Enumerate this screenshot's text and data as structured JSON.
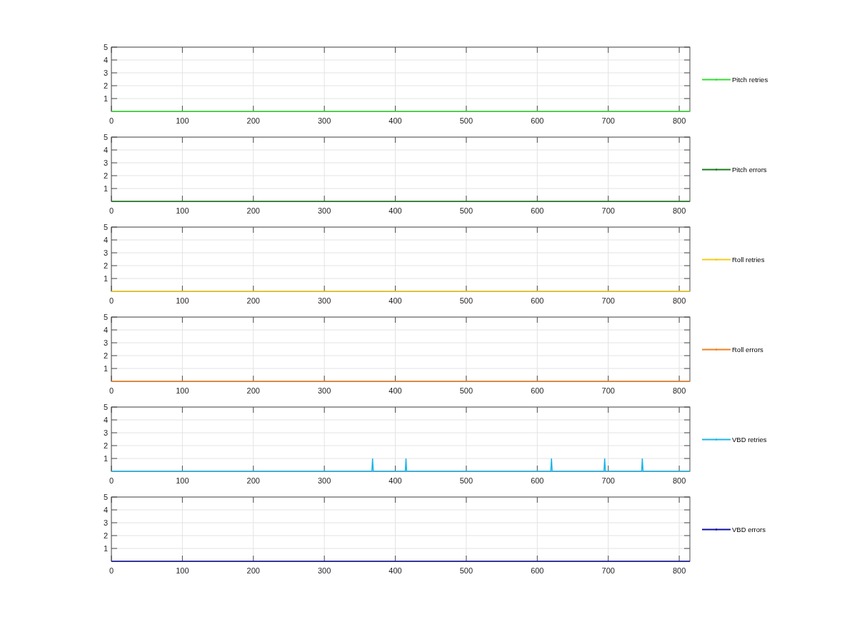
{
  "charts": [
    {
      "chart_data": {
        "type": "line",
        "grid": true,
        "x": [
          0,
          815
        ],
        "xlim": [
          0,
          815
        ],
        "ylim": [
          0,
          5
        ],
        "xticks": [
          0,
          100,
          200,
          300,
          400,
          500,
          600,
          700,
          800
        ],
        "yticks": [
          1,
          2,
          3,
          4,
          5
        ],
        "series": [
          {
            "name": "Pitch retries",
            "color": "#33dd33",
            "values": [
              0,
              0
            ]
          }
        ]
      }
    },
    {
      "chart_data": {
        "type": "line",
        "grid": true,
        "x": [
          0,
          815
        ],
        "xlim": [
          0,
          815
        ],
        "ylim": [
          0,
          5
        ],
        "xticks": [
          0,
          100,
          200,
          300,
          400,
          500,
          600,
          700,
          800
        ],
        "yticks": [
          1,
          2,
          3,
          4,
          5
        ],
        "series": [
          {
            "name": "Pitch errors",
            "color": "#1a7a1a",
            "values": [
              0,
              0
            ]
          }
        ]
      }
    },
    {
      "chart_data": {
        "type": "line",
        "grid": true,
        "x": [
          0,
          815
        ],
        "xlim": [
          0,
          815
        ],
        "ylim": [
          0,
          5
        ],
        "xticks": [
          0,
          100,
          200,
          300,
          400,
          500,
          600,
          700,
          800
        ],
        "yticks": [
          1,
          2,
          3,
          4,
          5
        ],
        "series": [
          {
            "name": "Roll retries",
            "color": "#f2cc1a",
            "values": [
              0,
              0
            ]
          }
        ]
      }
    },
    {
      "chart_data": {
        "type": "line",
        "grid": true,
        "x": [
          0,
          815
        ],
        "xlim": [
          0,
          815
        ],
        "ylim": [
          0,
          5
        ],
        "xticks": [
          0,
          100,
          200,
          300,
          400,
          500,
          600,
          700,
          800
        ],
        "yticks": [
          1,
          2,
          3,
          4,
          5
        ],
        "series": [
          {
            "name": "Roll errors",
            "color": "#f08020",
            "values": [
              0,
              0
            ]
          }
        ]
      }
    },
    {
      "chart_data": {
        "type": "line",
        "grid": true,
        "x": [
          0,
          367,
          368,
          369,
          414,
          415,
          416,
          619,
          620,
          621,
          694,
          695,
          696,
          747,
          748,
          749,
          815
        ],
        "xlim": [
          0,
          815
        ],
        "ylim": [
          0,
          5
        ],
        "xticks": [
          0,
          100,
          200,
          300,
          400,
          500,
          600,
          700,
          800
        ],
        "yticks": [
          1,
          2,
          3,
          4,
          5
        ],
        "series": [
          {
            "name": "VBD retries",
            "color": "#1fb4e6",
            "values": [
              0,
              0,
              1,
              0,
              0,
              1,
              0,
              0,
              1,
              0,
              0,
              1,
              0,
              0,
              1,
              0,
              0
            ]
          }
        ]
      }
    },
    {
      "chart_data": {
        "type": "line",
        "grid": true,
        "x": [
          0,
          815
        ],
        "xlim": [
          0,
          815
        ],
        "ylim": [
          0,
          5
        ],
        "xticks": [
          0,
          100,
          200,
          300,
          400,
          500,
          600,
          700,
          800
        ],
        "yticks": [
          1,
          2,
          3,
          4,
          5
        ],
        "series": [
          {
            "name": "VBD errors",
            "color": "#1010a0",
            "values": [
              0,
              0
            ]
          }
        ]
      }
    }
  ]
}
